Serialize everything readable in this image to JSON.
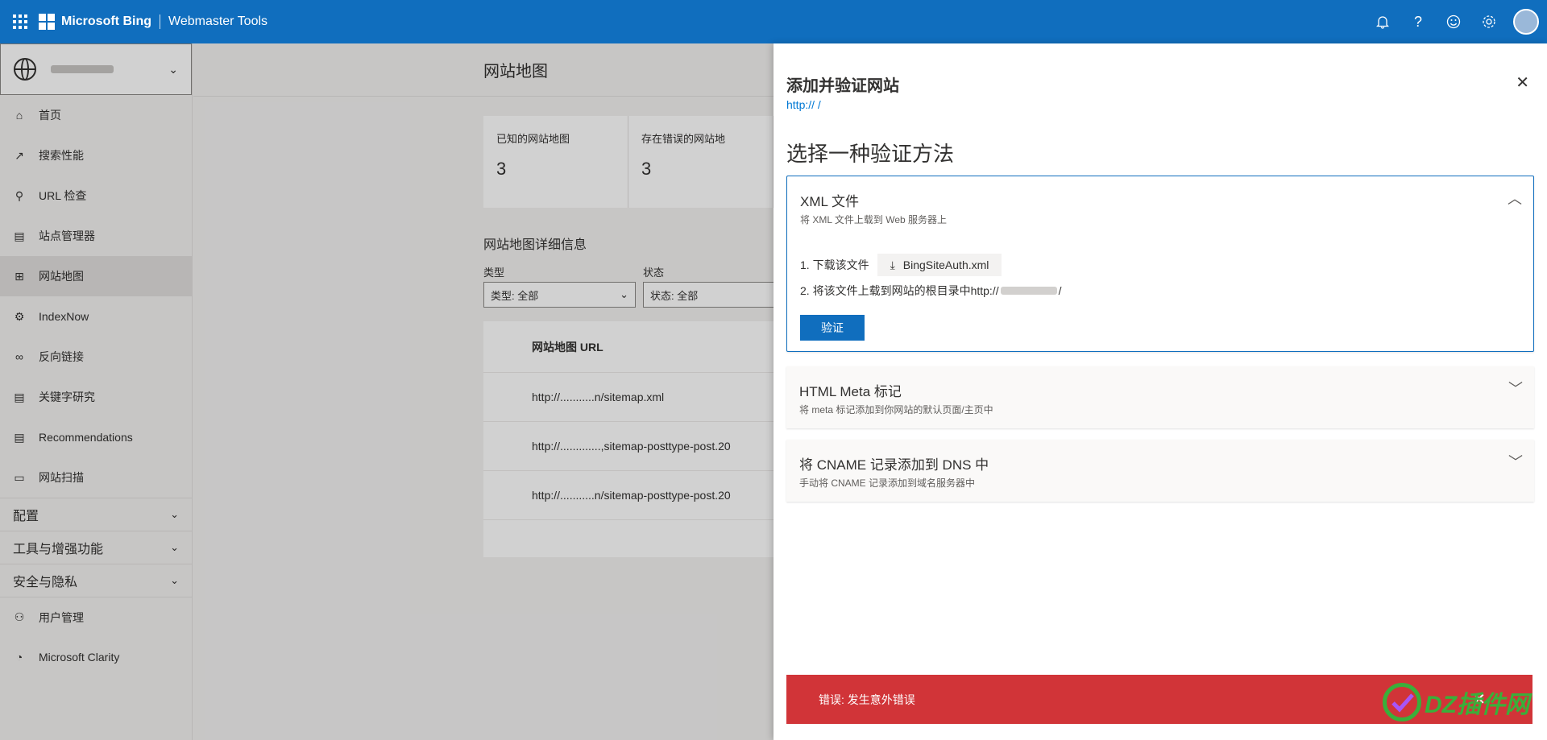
{
  "topbar": {
    "brand": "Microsoft Bing",
    "product": "Webmaster Tools",
    "icons": [
      "bell-icon",
      "help-icon",
      "feedback-icon",
      "settings-icon",
      "avatar"
    ]
  },
  "sidebar": {
    "items": [
      {
        "label": "首页",
        "icon": "home-icon"
      },
      {
        "label": "搜索性能",
        "icon": "trend-icon"
      },
      {
        "label": "URL 检查",
        "icon": "search-icon"
      },
      {
        "label": "站点管理器",
        "icon": "document-icon"
      },
      {
        "label": "网站地图",
        "icon": "sitemap-icon"
      },
      {
        "label": "IndexNow",
        "icon": "gear-icon"
      },
      {
        "label": "反向链接",
        "icon": "link-icon"
      },
      {
        "label": "关键字研究",
        "icon": "document-icon"
      },
      {
        "label": "Recommendations",
        "icon": "document-icon"
      },
      {
        "label": "网站扫描",
        "icon": "scan-icon"
      }
    ],
    "groups": [
      "配置",
      "工具与增强功能",
      "安全与隐私"
    ],
    "bottom_items": [
      {
        "label": "用户管理",
        "icon": "user-icon"
      },
      {
        "label": "Microsoft Clarity",
        "icon": "clarity-icon"
      }
    ]
  },
  "main": {
    "title": "网站地图",
    "stats": [
      {
        "label": "已知的网站地图",
        "value": "3"
      },
      {
        "label": "存在错误的网站地",
        "value": "3"
      }
    ],
    "details_title": "网站地图详细信息",
    "filters": [
      {
        "label": "类型",
        "value": "类型: 全部"
      },
      {
        "label": "状态",
        "value": "状态: 全部"
      }
    ],
    "table": {
      "header": "网站地图 URL",
      "rows": [
        "http://...........n/sitemap.xml",
        "http://.............,sitemap-posttype-post.20",
        "http://...........n/sitemap-posttype-post.20"
      ]
    }
  },
  "panel": {
    "title": "添加并验证网站",
    "url": "http://                  /",
    "subtitle": "选择一种验证方法",
    "close": "✕",
    "options": [
      {
        "title": "XML 文件",
        "desc": "将 XML 文件上载到 Web 服务器上",
        "expanded": true
      },
      {
        "title": "HTML Meta 标记",
        "desc": "将 meta 标记添加到你网站的默认页面/主页中",
        "expanded": false
      },
      {
        "title": "将 CNAME 记录添加到 DNS 中",
        "desc": "手动将 CNAME 记录添加到域名服务器中",
        "expanded": false
      }
    ],
    "step1": "1. 下载该文件",
    "download_file": "BingSiteAuth.xml",
    "step2_prefix": "2. 将该文件上载到网站的根目录中http://",
    "step2_suffix": "/",
    "verify": "验证"
  },
  "toast": {
    "message": "错误: 发生意外错误",
    "close": "✕",
    "color": "#d13438"
  },
  "watermark": {
    "text": "DZ插件网"
  },
  "colors": {
    "accent": "#106ebe",
    "link": "#0078d4"
  }
}
